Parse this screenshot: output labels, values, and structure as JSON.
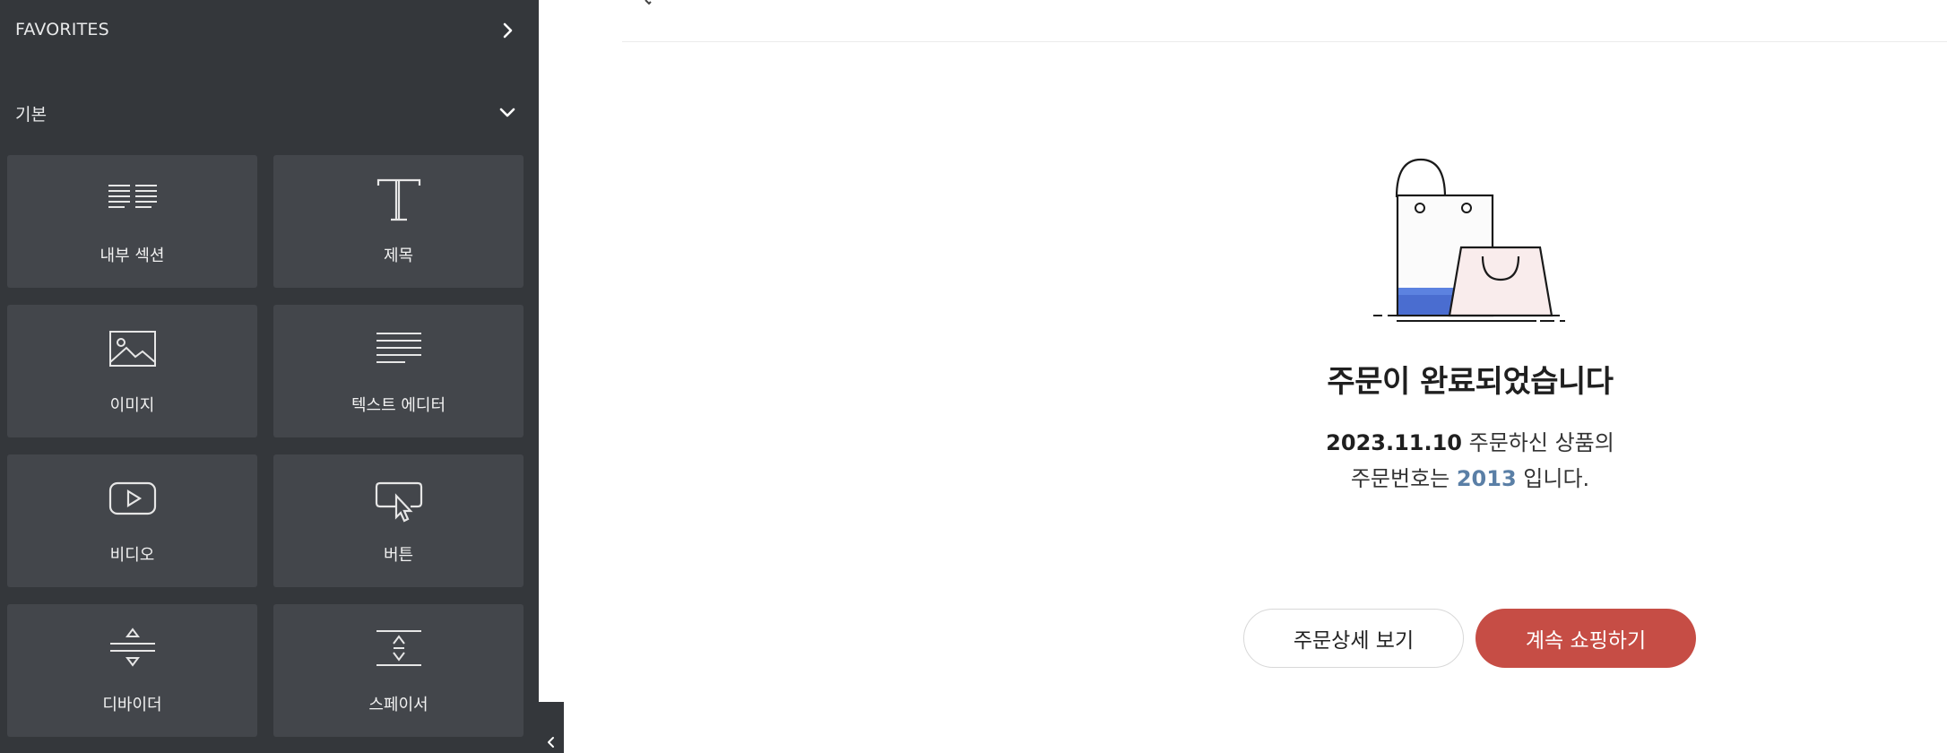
{
  "panel": {
    "favorites_label": "FAVORITES",
    "basic_label": "기본",
    "widgets": [
      {
        "label": "내부 섹션",
        "icon": "inner-section-icon"
      },
      {
        "label": "제목",
        "icon": "heading-icon"
      },
      {
        "label": "이미지",
        "icon": "image-icon"
      },
      {
        "label": "텍스트 에디터",
        "icon": "text-editor-icon"
      },
      {
        "label": "비디오",
        "icon": "video-icon"
      },
      {
        "label": "버튼",
        "icon": "button-icon"
      },
      {
        "label": "디바이더",
        "icon": "divider-icon"
      },
      {
        "label": "스페이서",
        "icon": "spacer-icon"
      }
    ]
  },
  "order": {
    "title": "주문이 완료되었습니다",
    "date": "2023.11.10",
    "line1_rest": " 주문하신 상품의",
    "line2_prefix": "주문번호는 ",
    "order_number": "2013",
    "line2_suffix": " 입니다."
  },
  "buttons": {
    "detail_label": "주문상세 보기",
    "shop_label": "계속 쇼핑하기"
  },
  "colors": {
    "panel_bg": "#34373b",
    "widget_bg": "#43464b",
    "accent": "#c64d45",
    "order_number": "#5a7fa6"
  }
}
